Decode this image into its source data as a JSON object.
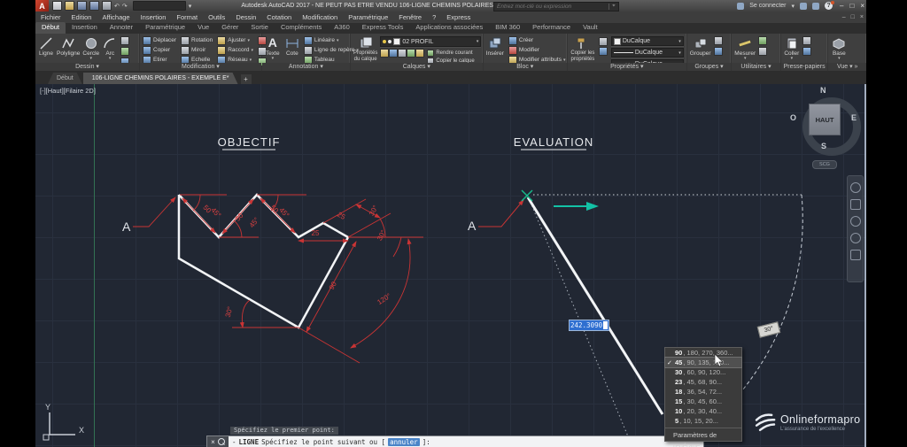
{
  "titlebar": {
    "logo": "A",
    "title": "Autodesk AutoCAD 2017 - NE PEUT PAS ETRE VENDU   106-LIGNE CHEMINS POLAIRES - EXEMPLE E.dwg",
    "search_placeholder": "Entrez mot-clé ou expression",
    "signin": "Se connecter",
    "min": "–",
    "max": "□",
    "close": "×"
  },
  "menubar": {
    "items": [
      "Fichier",
      "Edition",
      "Affichage",
      "Insertion",
      "Format",
      "Outils",
      "Dessin",
      "Cotation",
      "Modification",
      "Paramétrique",
      "Fenêtre",
      "?",
      "Express"
    ],
    "mdi_min": "–",
    "mdi_max": "□",
    "mdi_close": "×"
  },
  "ribbon_tabs": {
    "items": [
      "Début",
      "Insertion",
      "Annoter",
      "Paramétrique",
      "Vue",
      "Gérer",
      "Sortie",
      "Compléments",
      "A360",
      "Express Tools",
      "Applications associées",
      "BIM 360",
      "Performance",
      "Vault"
    ]
  },
  "ribbon": {
    "dessin": {
      "title": "Dessin",
      "ligne": "Ligne",
      "polyligne": "Polyligne",
      "cercle": "Cercle",
      "arc": "Arc"
    },
    "modification": {
      "title": "Modification",
      "deplacer": "Déplacer",
      "copier": "Copier",
      "etirer": "Etirer",
      "rotation": "Rotation",
      "miroir": "Miroir",
      "echelle": "Echelle",
      "ajuster": "Ajuster",
      "raccord": "Raccord",
      "reseau": "Réseau"
    },
    "annotation": {
      "title": "Annotation",
      "texte": "Texte",
      "cote": "Cote",
      "lineaire": "Linéaire",
      "repere": "Ligne de repère",
      "tableau": "Tableau"
    },
    "calques": {
      "title": "Calques",
      "proprietes": "Propriétés du calque",
      "layer": "02 PROFIL",
      "rendre": "Rendre courant",
      "copier": "Copier le calque"
    },
    "bloc": {
      "title": "Bloc",
      "inserer": "Insérer",
      "creer": "Créer",
      "modifier": "Modifier",
      "attributs": "Modifier attributs"
    },
    "proprietes": {
      "title": "Propriétés",
      "copier": "Copier les propriétés",
      "c1": "DuCalque",
      "c2": "DuCalque",
      "c3": "DuCalque"
    },
    "groupes": {
      "title": "Groupes",
      "grouper": "Grouper"
    },
    "utilitaires": {
      "title": "Utilitaires",
      "mesurer": "Mesurer"
    },
    "presse": {
      "title": "Presse-papiers",
      "coller": "Coller"
    },
    "vue": {
      "title": "Vue",
      "base": "Base"
    }
  },
  "doc_tabs": {
    "start": "Début",
    "doc": "106-LIGNE CHEMINS POLAIRES - EXEMPLE E*",
    "plus": "+"
  },
  "canvas": {
    "viewport_label": "[-][Haut][Filaire 2D]",
    "objectif": {
      "title": "OBJECTIF",
      "label_a": "A",
      "d50a": "50",
      "d45a": "45°",
      "d50b": "50",
      "d45b": "45°",
      "d50c": "50",
      "d45c": "45°",
      "d25h": "25",
      "d25r": "25",
      "d30r1": "30°",
      "d30r2": "30°",
      "d90": "90",
      "d120": "120°",
      "d30bl": "30°"
    },
    "evaluation": {
      "title": "EVALUATION",
      "label_a": "A",
      "dyn_input": "242.3090",
      "angle_badge": "30°"
    },
    "viewcube": {
      "n": "N",
      "o": "O",
      "e": "E",
      "s": "S",
      "haut": "HAUT",
      "scg": "SCG"
    },
    "ucs": {
      "x": "X",
      "y": "Y"
    }
  },
  "tracking_menu": {
    "check": "✓",
    "checked_index": 1,
    "items": [
      {
        "lead": "90",
        "rest": ", 180, 270, 360..."
      },
      {
        "lead": "45",
        "rest": ", 90, 135, 180..."
      },
      {
        "lead": "30",
        "rest": ", 60, 90, 120..."
      },
      {
        "lead": "23",
        "rest": ", 45, 68, 90..."
      },
      {
        "lead": "18",
        "rest": ", 36, 54, 72..."
      },
      {
        "lead": "15",
        "rest": ", 30, 45, 60..."
      },
      {
        "lead": "10",
        "rest": ", 20, 30, 40..."
      },
      {
        "lead": "5",
        "rest": ", 10, 15, 20..."
      }
    ],
    "settings": "Paramètres de repérage..."
  },
  "command": {
    "history": "Spécifiez le premier point:",
    "dash": "-",
    "name": "LIGNE",
    "prompt": "Spécifiez le point suivant ou [",
    "option": "annuler",
    "suffix": "]:",
    "close": "×"
  },
  "watermark": {
    "name": "Onlineformapro",
    "tagline": "L'assurance de l'excellence"
  },
  "colors": {
    "accent_red": "#c93434",
    "line_white": "#f2f4f6",
    "tracking_teal": "#13c2a6",
    "marker_green": "#17b98a",
    "input_blue": "#2f6fd0",
    "canvas_bg": "#212733"
  }
}
